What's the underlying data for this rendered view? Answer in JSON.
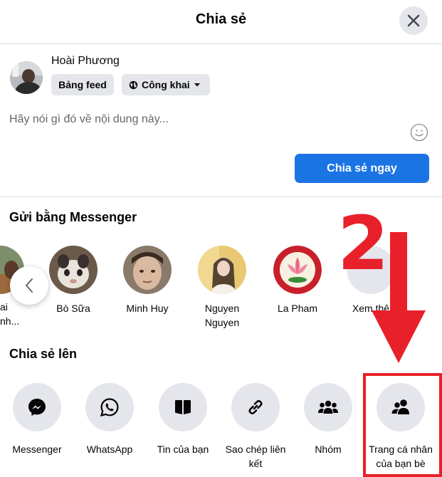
{
  "dialog": {
    "title": "Chia sẻ"
  },
  "composer": {
    "user_name": "Hoài Phương",
    "destination_label": "Bảng feed",
    "privacy_label": "Công khai",
    "placeholder": "Hãy nói gì đó về nội dung này...",
    "share_now_label": "Chia sẻ ngay"
  },
  "messenger": {
    "title": "Gửi bằng Messenger",
    "contacts": [
      {
        "name": "ai",
        "name2": "nh...",
        "partial": true
      },
      {
        "name": "Bò Sữa",
        "name2": ""
      },
      {
        "name": "Minh Huy",
        "name2": ""
      },
      {
        "name": "Nguyen",
        "name2": "Nguyen"
      },
      {
        "name": "La Pham",
        "name2": ""
      },
      {
        "name": "Xem thê",
        "name2": ""
      }
    ]
  },
  "share_to": {
    "title": "Chia sẻ lên",
    "items": [
      {
        "icon": "messenger-icon",
        "line1": "Messenger",
        "line2": ""
      },
      {
        "icon": "whatsapp-icon",
        "line1": "WhatsApp",
        "line2": ""
      },
      {
        "icon": "book-icon",
        "line1": "Tin của bạn",
        "line2": ""
      },
      {
        "icon": "link-icon",
        "line1": "Sao chép liên",
        "line2": "kết"
      },
      {
        "icon": "group-icon",
        "line1": "Nhóm",
        "line2": ""
      },
      {
        "icon": "friends-icon",
        "line1": "Trang cá nhân",
        "line2": "của bạn bè"
      }
    ]
  },
  "annotation": {
    "step_number": "2",
    "color": "#e8202a"
  },
  "colors": {
    "primary": "#1b74e4",
    "button_gray": "#e4e6eb",
    "annotation_red": "#e8202a"
  }
}
